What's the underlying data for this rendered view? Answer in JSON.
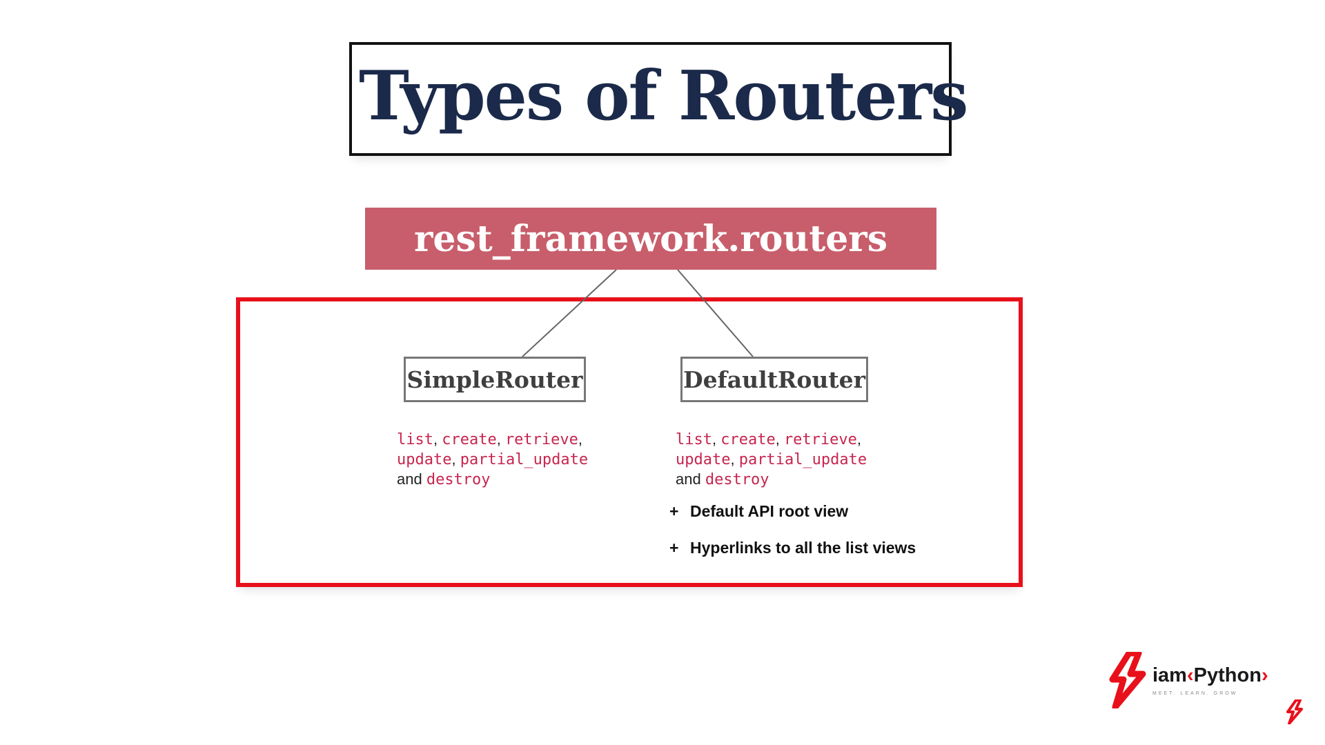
{
  "title": "Types of Routers",
  "module": "rest_framework.routers",
  "routers": [
    {
      "name": "SimpleRouter",
      "lines": [
        [
          {
            "t": "list",
            "code": true
          },
          {
            "t": ", ",
            "code": false
          },
          {
            "t": "create",
            "code": true
          },
          {
            "t": ", ",
            "code": false
          },
          {
            "t": "retrieve",
            "code": true
          },
          {
            "t": ",",
            "code": false
          }
        ],
        [
          {
            "t": "update",
            "code": true
          },
          {
            "t": ", ",
            "code": false
          },
          {
            "t": "partial_update",
            "code": true
          }
        ],
        [
          {
            "t": "and ",
            "code": false
          },
          {
            "t": "destroy",
            "code": true
          }
        ]
      ]
    },
    {
      "name": "DefaultRouter",
      "lines": [
        [
          {
            "t": "list",
            "code": true
          },
          {
            "t": ", ",
            "code": false
          },
          {
            "t": "create",
            "code": true
          },
          {
            "t": ", ",
            "code": false
          },
          {
            "t": "retrieve",
            "code": true
          },
          {
            "t": ",",
            "code": false
          }
        ],
        [
          {
            "t": "update",
            "code": true
          },
          {
            "t": ", ",
            "code": false
          },
          {
            "t": "partial_update",
            "code": true
          }
        ],
        [
          {
            "t": "and ",
            "code": false
          },
          {
            "t": "destroy",
            "code": true
          }
        ]
      ]
    }
  ],
  "extras": [
    {
      "symbol": "+",
      "label": "Default API root view"
    },
    {
      "symbol": "+",
      "label": "Hyperlinks to all the list views"
    }
  ],
  "logo": {
    "prefix": "iam",
    "open": "‹",
    "name": "Python",
    "close": "›",
    "tagline": "MEET. LEARN. GROW"
  },
  "colors": {
    "title": "#1b2a4a",
    "module_bg": "#c85e6b",
    "highlight_border": "#e8101b",
    "code_text": "#c7254e",
    "brand_red": "#e8101b"
  },
  "icons": {
    "logo_mark": "bolt-logo-icon",
    "corner_mark": "bolt-corner-icon"
  }
}
